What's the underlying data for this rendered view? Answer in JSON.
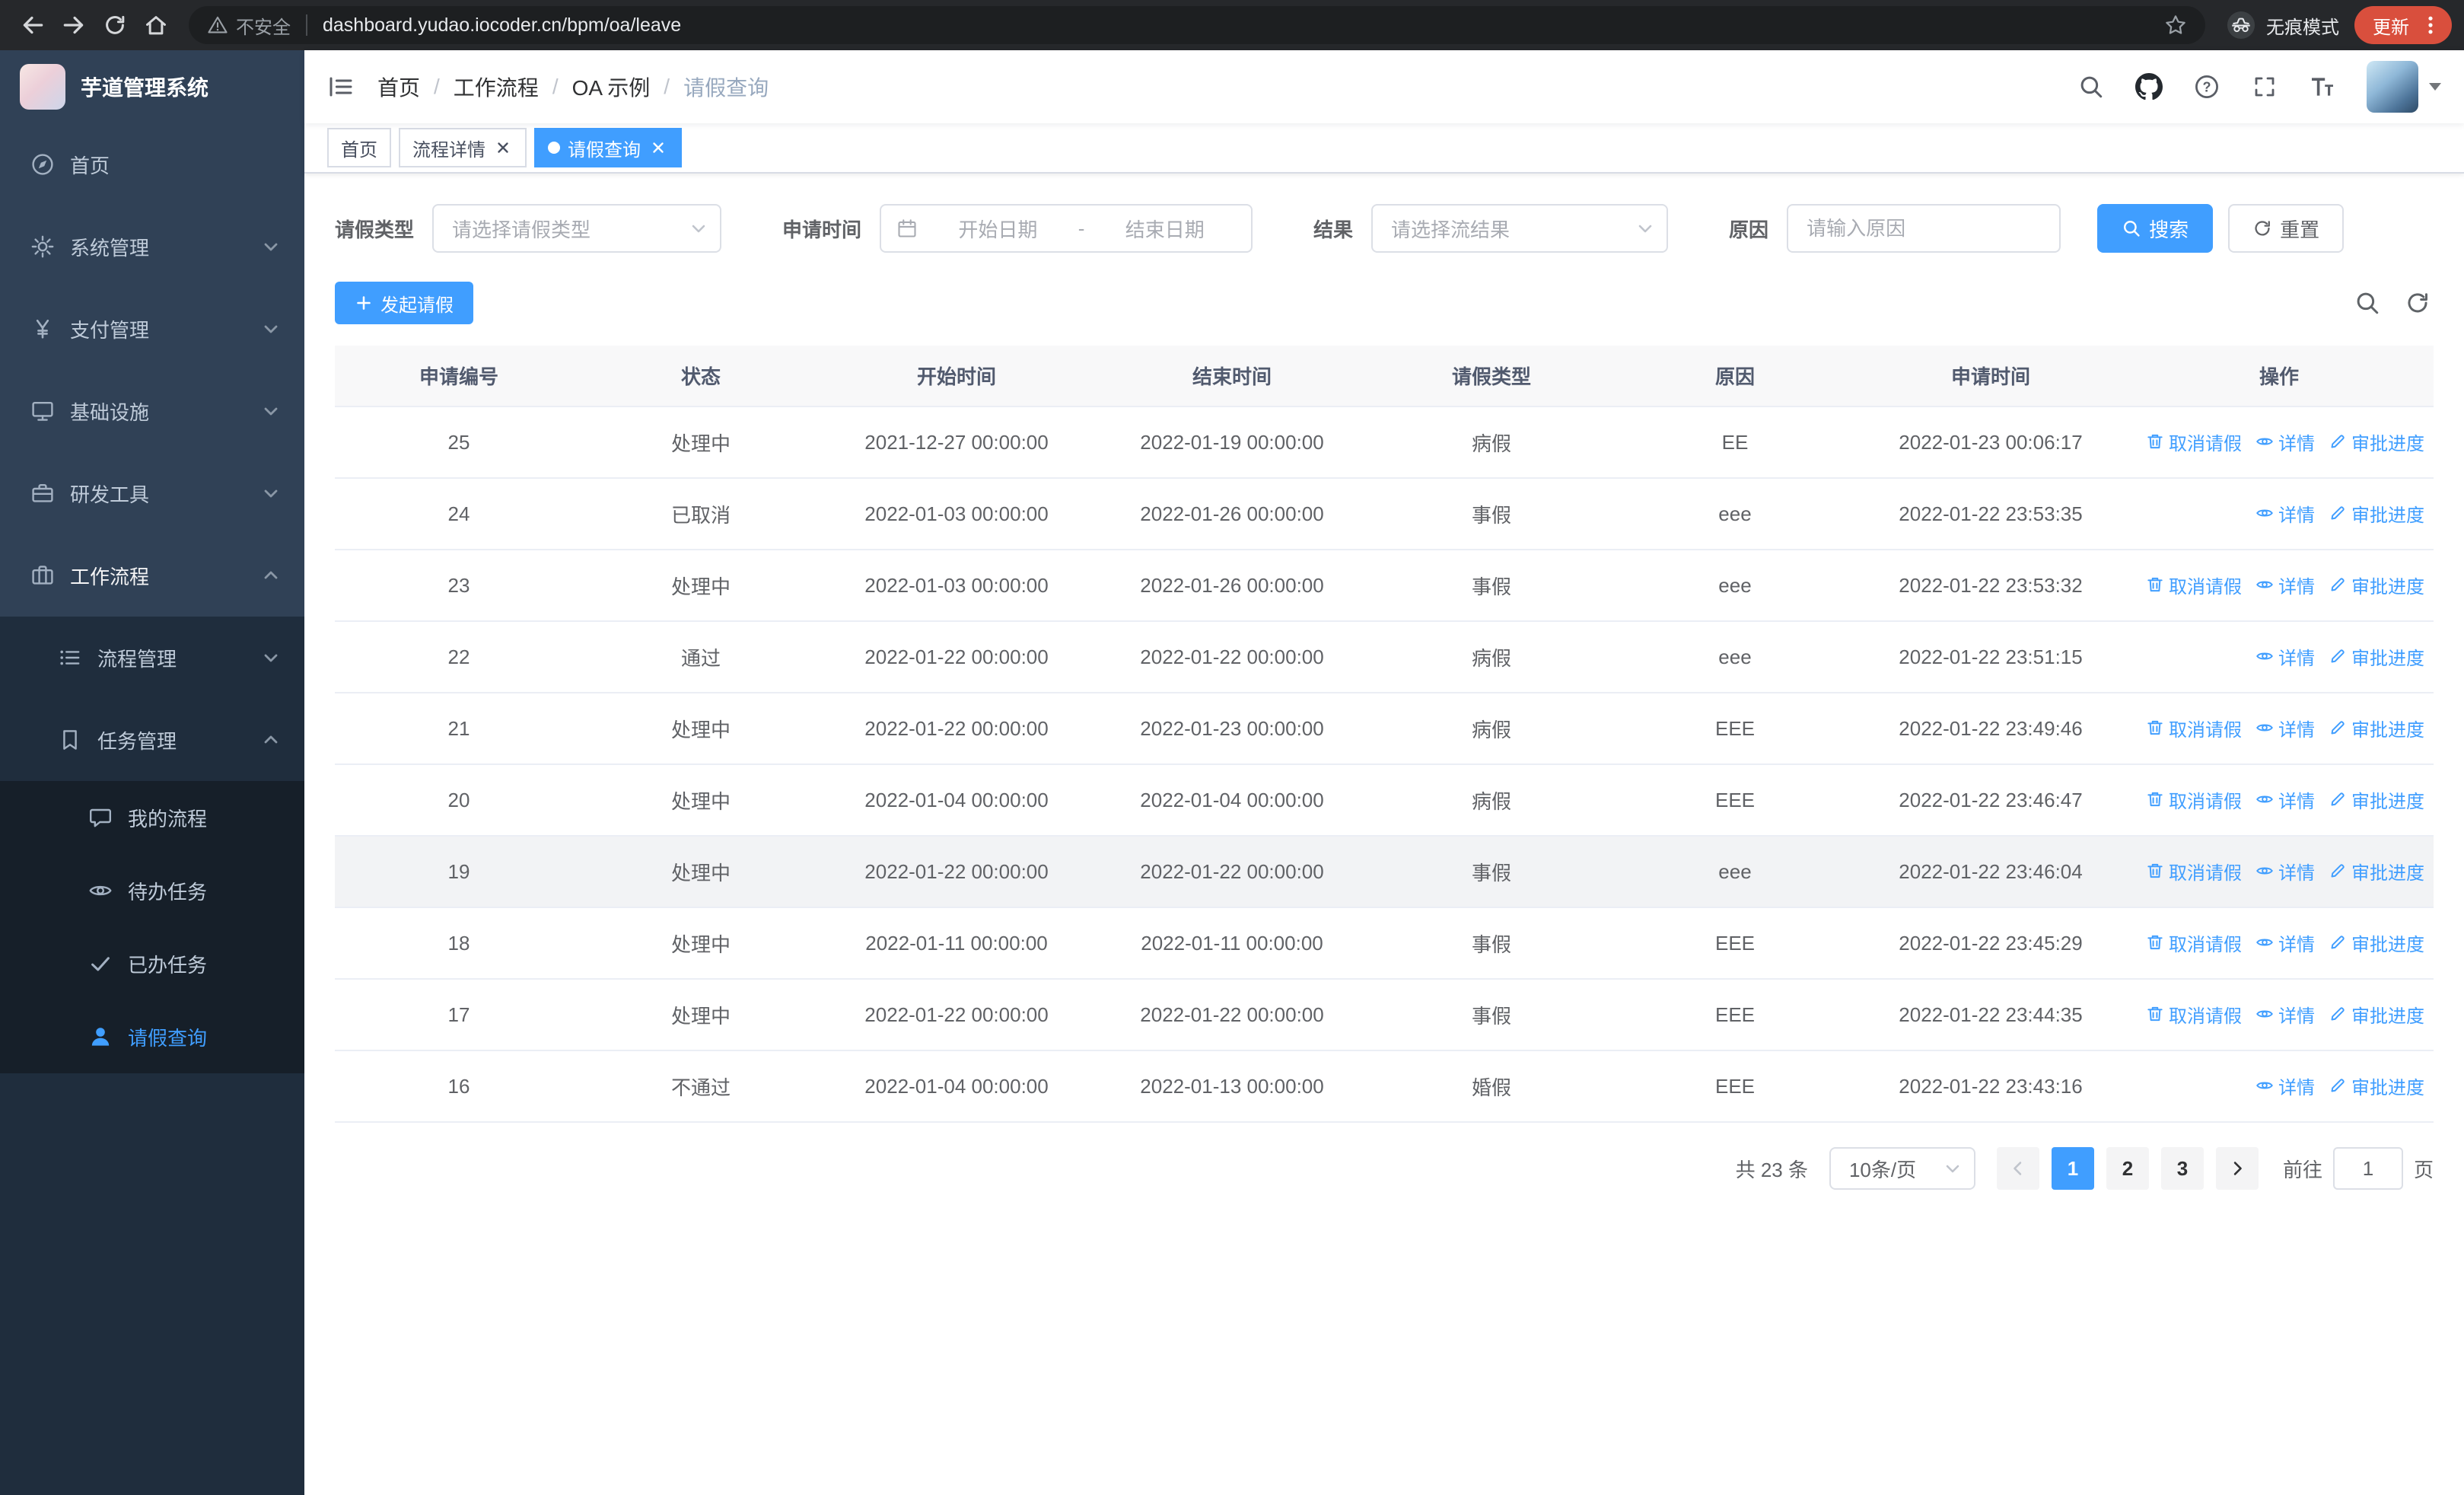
{
  "browser": {
    "security_label": "不安全",
    "url": "dashboard.yudao.iocoder.cn/bpm/oa/leave",
    "incognito_label": "无痕模式",
    "update_label": "更新"
  },
  "sidebar": {
    "logo_title": "芋道管理系统",
    "items": [
      {
        "label": "首页"
      },
      {
        "label": "系统管理"
      },
      {
        "label": "支付管理"
      },
      {
        "label": "基础设施"
      },
      {
        "label": "研发工具"
      },
      {
        "label": "工作流程"
      },
      {
        "label": "流程管理"
      },
      {
        "label": "任务管理"
      },
      {
        "label": "我的流程"
      },
      {
        "label": "待办任务"
      },
      {
        "label": "已办任务"
      },
      {
        "label": "请假查询"
      }
    ]
  },
  "navbar": {
    "separator": "/",
    "breadcrumb": [
      {
        "label": "首页"
      },
      {
        "label": "工作流程"
      },
      {
        "label": "OA 示例"
      },
      {
        "label": "请假查询"
      }
    ]
  },
  "tags": [
    {
      "label": "首页"
    },
    {
      "label": "流程详情"
    },
    {
      "label": "请假查询"
    }
  ],
  "filters": {
    "leave_type_label": "请假类型",
    "leave_type_placeholder": "请选择请假类型",
    "apply_time_label": "申请时间",
    "start_placeholder": "开始日期",
    "range_separator": "-",
    "end_placeholder": "结束日期",
    "result_label": "结果",
    "result_placeholder": "请选择流结果",
    "reason_label": "原因",
    "reason_placeholder": "请输入原因",
    "search_button": "搜索",
    "reset_button": "重置"
  },
  "toolbar": {
    "create_button": "发起请假"
  },
  "table": {
    "columns": [
      "申请编号",
      "状态",
      "开始时间",
      "结束时间",
      "请假类型",
      "原因",
      "申请时间",
      "操作"
    ],
    "action_labels": {
      "cancel": "取消请假",
      "detail": "详情",
      "progress": "审批进度"
    },
    "rows": [
      {
        "id": "25",
        "status": "处理中",
        "start": "2021-12-27 00:00:00",
        "end": "2022-01-19 00:00:00",
        "type": "病假",
        "reason": "EE",
        "apply_time": "2022-01-23 00:06:17",
        "actions": [
          "cancel",
          "detail",
          "progress"
        ],
        "highlight": false
      },
      {
        "id": "24",
        "status": "已取消",
        "start": "2022-01-03 00:00:00",
        "end": "2022-01-26 00:00:00",
        "type": "事假",
        "reason": "eee",
        "apply_time": "2022-01-22 23:53:35",
        "actions": [
          "detail",
          "progress"
        ],
        "highlight": false
      },
      {
        "id": "23",
        "status": "处理中",
        "start": "2022-01-03 00:00:00",
        "end": "2022-01-26 00:00:00",
        "type": "事假",
        "reason": "eee",
        "apply_time": "2022-01-22 23:53:32",
        "actions": [
          "cancel",
          "detail",
          "progress"
        ],
        "highlight": false
      },
      {
        "id": "22",
        "status": "通过",
        "start": "2022-01-22 00:00:00",
        "end": "2022-01-22 00:00:00",
        "type": "病假",
        "reason": "eee",
        "apply_time": "2022-01-22 23:51:15",
        "actions": [
          "detail",
          "progress"
        ],
        "highlight": false
      },
      {
        "id": "21",
        "status": "处理中",
        "start": "2022-01-22 00:00:00",
        "end": "2022-01-23 00:00:00",
        "type": "病假",
        "reason": "EEE",
        "apply_time": "2022-01-22 23:49:46",
        "actions": [
          "cancel",
          "detail",
          "progress"
        ],
        "highlight": false
      },
      {
        "id": "20",
        "status": "处理中",
        "start": "2022-01-04 00:00:00",
        "end": "2022-01-04 00:00:00",
        "type": "病假",
        "reason": "EEE",
        "apply_time": "2022-01-22 23:46:47",
        "actions": [
          "cancel",
          "detail",
          "progress"
        ],
        "highlight": false
      },
      {
        "id": "19",
        "status": "处理中",
        "start": "2022-01-22 00:00:00",
        "end": "2022-01-22 00:00:00",
        "type": "事假",
        "reason": "eee",
        "apply_time": "2022-01-22 23:46:04",
        "actions": [
          "cancel",
          "detail",
          "progress"
        ],
        "highlight": true
      },
      {
        "id": "18",
        "status": "处理中",
        "start": "2022-01-11 00:00:00",
        "end": "2022-01-11 00:00:00",
        "type": "事假",
        "reason": "EEE",
        "apply_time": "2022-01-22 23:45:29",
        "actions": [
          "cancel",
          "detail",
          "progress"
        ],
        "highlight": false
      },
      {
        "id": "17",
        "status": "处理中",
        "start": "2022-01-22 00:00:00",
        "end": "2022-01-22 00:00:00",
        "type": "事假",
        "reason": "EEE",
        "apply_time": "2022-01-22 23:44:35",
        "actions": [
          "cancel",
          "detail",
          "progress"
        ],
        "highlight": false
      },
      {
        "id": "16",
        "status": "不通过",
        "start": "2022-01-04 00:00:00",
        "end": "2022-01-13 00:00:00",
        "type": "婚假",
        "reason": "EEE",
        "apply_time": "2022-01-22 23:43:16",
        "actions": [
          "detail",
          "progress"
        ],
        "highlight": false
      }
    ]
  },
  "pagination": {
    "total": "共 23 条",
    "page_size": "10条/页",
    "pages": [
      "1",
      "2",
      "3"
    ],
    "active_page": "1",
    "goto_label": "前往",
    "goto_value": "1",
    "goto_suffix": "页"
  },
  "colors": {
    "primary": "#409eff",
    "sidebar_bg": "#304156",
    "submenu_bg": "#1f2d3d",
    "update_pill": "#d94f3d"
  }
}
